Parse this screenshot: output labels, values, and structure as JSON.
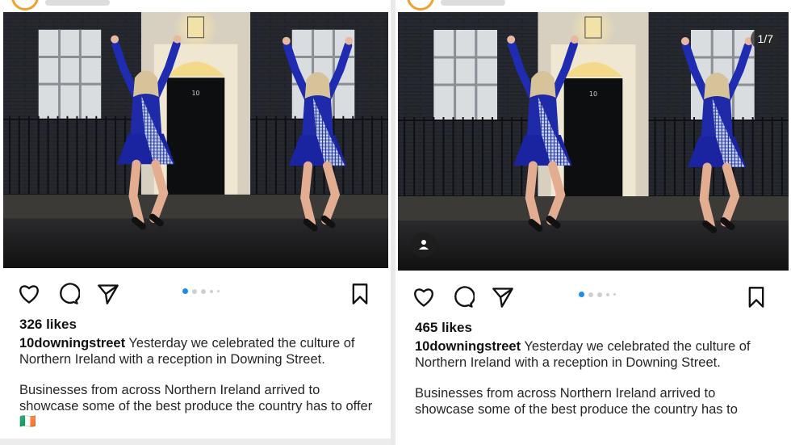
{
  "posts": [
    {
      "likes": "326 likes",
      "username": "10downingstreet",
      "caption_line1": "Yesterday we celebrated the culture of Northern Ireland with a reception in Downing Street.",
      "caption_para2": "Businesses from across Northern Ireland arrived to showcase some of the best produce the country has to offer",
      "flag": "🇮🇪",
      "carousel_dots": 5,
      "carousel_active": 0
    },
    {
      "likes": "465 likes",
      "username": "10downingstreet",
      "caption_line1": "Yesterday we celebrated the culture of Northern Ireland with a reception in Downing Street.",
      "caption_para2": "Businesses from across Northern Ireland arrived to showcase some of the best produce the country has to",
      "counter": "1/7",
      "carousel_dots": 5,
      "carousel_active": 0
    }
  ],
  "door_number": "10",
  "icons": [
    "heart-icon",
    "comment-icon",
    "share-icon",
    "bookmark-icon",
    "user-tag-icon"
  ],
  "colors": {
    "accent_dot": "#1a8cf0",
    "dress_blue": "#1e2aa8",
    "tartan": "#9fb3e8"
  }
}
